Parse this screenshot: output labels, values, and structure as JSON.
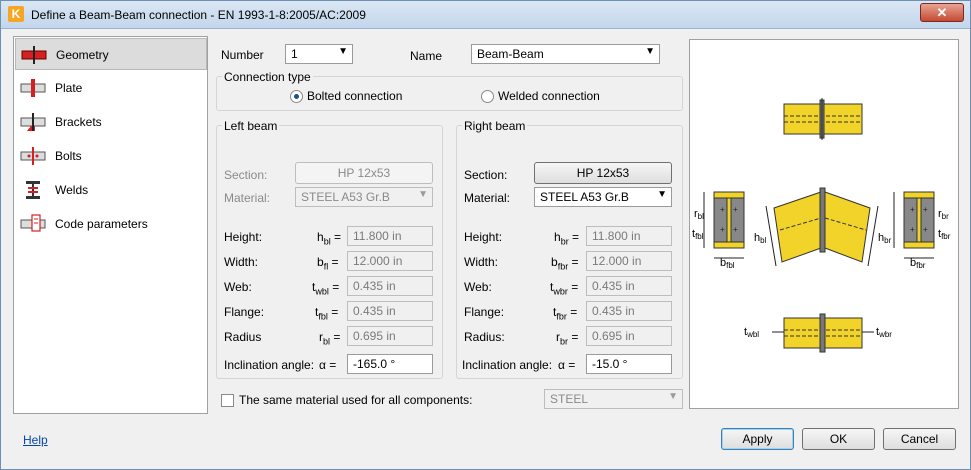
{
  "window": {
    "title": "Define a Beam-Beam connection - EN 1993-1-8:2005/AC:2009",
    "app_icon_letter": "K"
  },
  "sidebar": {
    "items": [
      {
        "label": "Geometry",
        "icon": "geometry-icon",
        "active": true
      },
      {
        "label": "Plate",
        "icon": "plate-icon"
      },
      {
        "label": "Brackets",
        "icon": "brackets-icon"
      },
      {
        "label": "Bolts",
        "icon": "bolts-icon"
      },
      {
        "label": "Welds",
        "icon": "welds-icon"
      },
      {
        "label": "Code parameters",
        "icon": "code-parameters-icon"
      }
    ]
  },
  "header": {
    "number_label": "Number",
    "number_value": "1",
    "name_label": "Name",
    "name_value": "Beam-Beam"
  },
  "connection_type": {
    "label": "Connection type",
    "bolted": "Bolted connection",
    "welded": "Welded connection",
    "selected": "bolted"
  },
  "left_beam": {
    "title": "Left beam",
    "section_label": "Section:",
    "section_value": "HP 12x53",
    "material_label": "Material:",
    "material_value": "STEEL A53 Gr.B",
    "rows": [
      {
        "label": "Height:",
        "sym": "h",
        "sub": "bl",
        "value": "11.800 in"
      },
      {
        "label": "Width:",
        "sym": "b",
        "sub": "fl",
        "value": "12.000 in"
      },
      {
        "label": "Web:",
        "sym": "t",
        "sub": "wbl",
        "value": "0.435 in"
      },
      {
        "label": "Flange:",
        "sym": "t",
        "sub": "fbl",
        "value": "0.435 in"
      },
      {
        "label": "Radius",
        "sym": "r",
        "sub": "bl",
        "value": "0.695 in"
      }
    ],
    "incl_label": "Inclination angle:",
    "incl_sym": "α",
    "incl_value": "-165.0 °"
  },
  "right_beam": {
    "title": "Right beam",
    "section_label": "Section:",
    "section_value": "HP 12x53",
    "material_label": "Material:",
    "material_value": "STEEL A53 Gr.B",
    "rows": [
      {
        "label": "Height:",
        "sym": "h",
        "sub": "br",
        "value": "11.800 in"
      },
      {
        "label": "Width:",
        "sym": "b",
        "sub": "fbr",
        "value": "12.000 in"
      },
      {
        "label": "Web:",
        "sym": "t",
        "sub": "wbr",
        "value": "0.435 in"
      },
      {
        "label": "Flange:",
        "sym": "t",
        "sub": "fbr",
        "value": "0.435 in"
      },
      {
        "label": "Radius:",
        "sym": "r",
        "sub": "br",
        "value": "0.695 in"
      }
    ],
    "incl_label": "Inclination angle:",
    "incl_sym": "α",
    "incl_value": "-15.0 °"
  },
  "same_material": {
    "label": "The same material used for all components:",
    "value": "STEEL",
    "checked": false
  },
  "preview_labels": {
    "rbl": "r",
    "rbl_sub": "bl",
    "tfbl": "t",
    "tfbl_sub": "fbl",
    "hbl": "h",
    "hbl_sub": "bl",
    "bfbl": "b",
    "bfbl_sub": "fbl",
    "hbr": "h",
    "hbr_sub": "br",
    "rbr": "r",
    "rbr_sub": "br",
    "tfbr": "t",
    "tfbr_sub": "fbr",
    "bfbr": "b",
    "bfbr_sub": "fbr",
    "twbl": "t",
    "twbl_sub": "wbl",
    "twbr": "t",
    "twbr_sub": "wbr"
  },
  "footer": {
    "help": "Help",
    "apply": "Apply",
    "ok": "OK",
    "cancel": "Cancel"
  },
  "colors": {
    "beam_fill": "#f2d32a",
    "accent_red": "#d42020"
  }
}
